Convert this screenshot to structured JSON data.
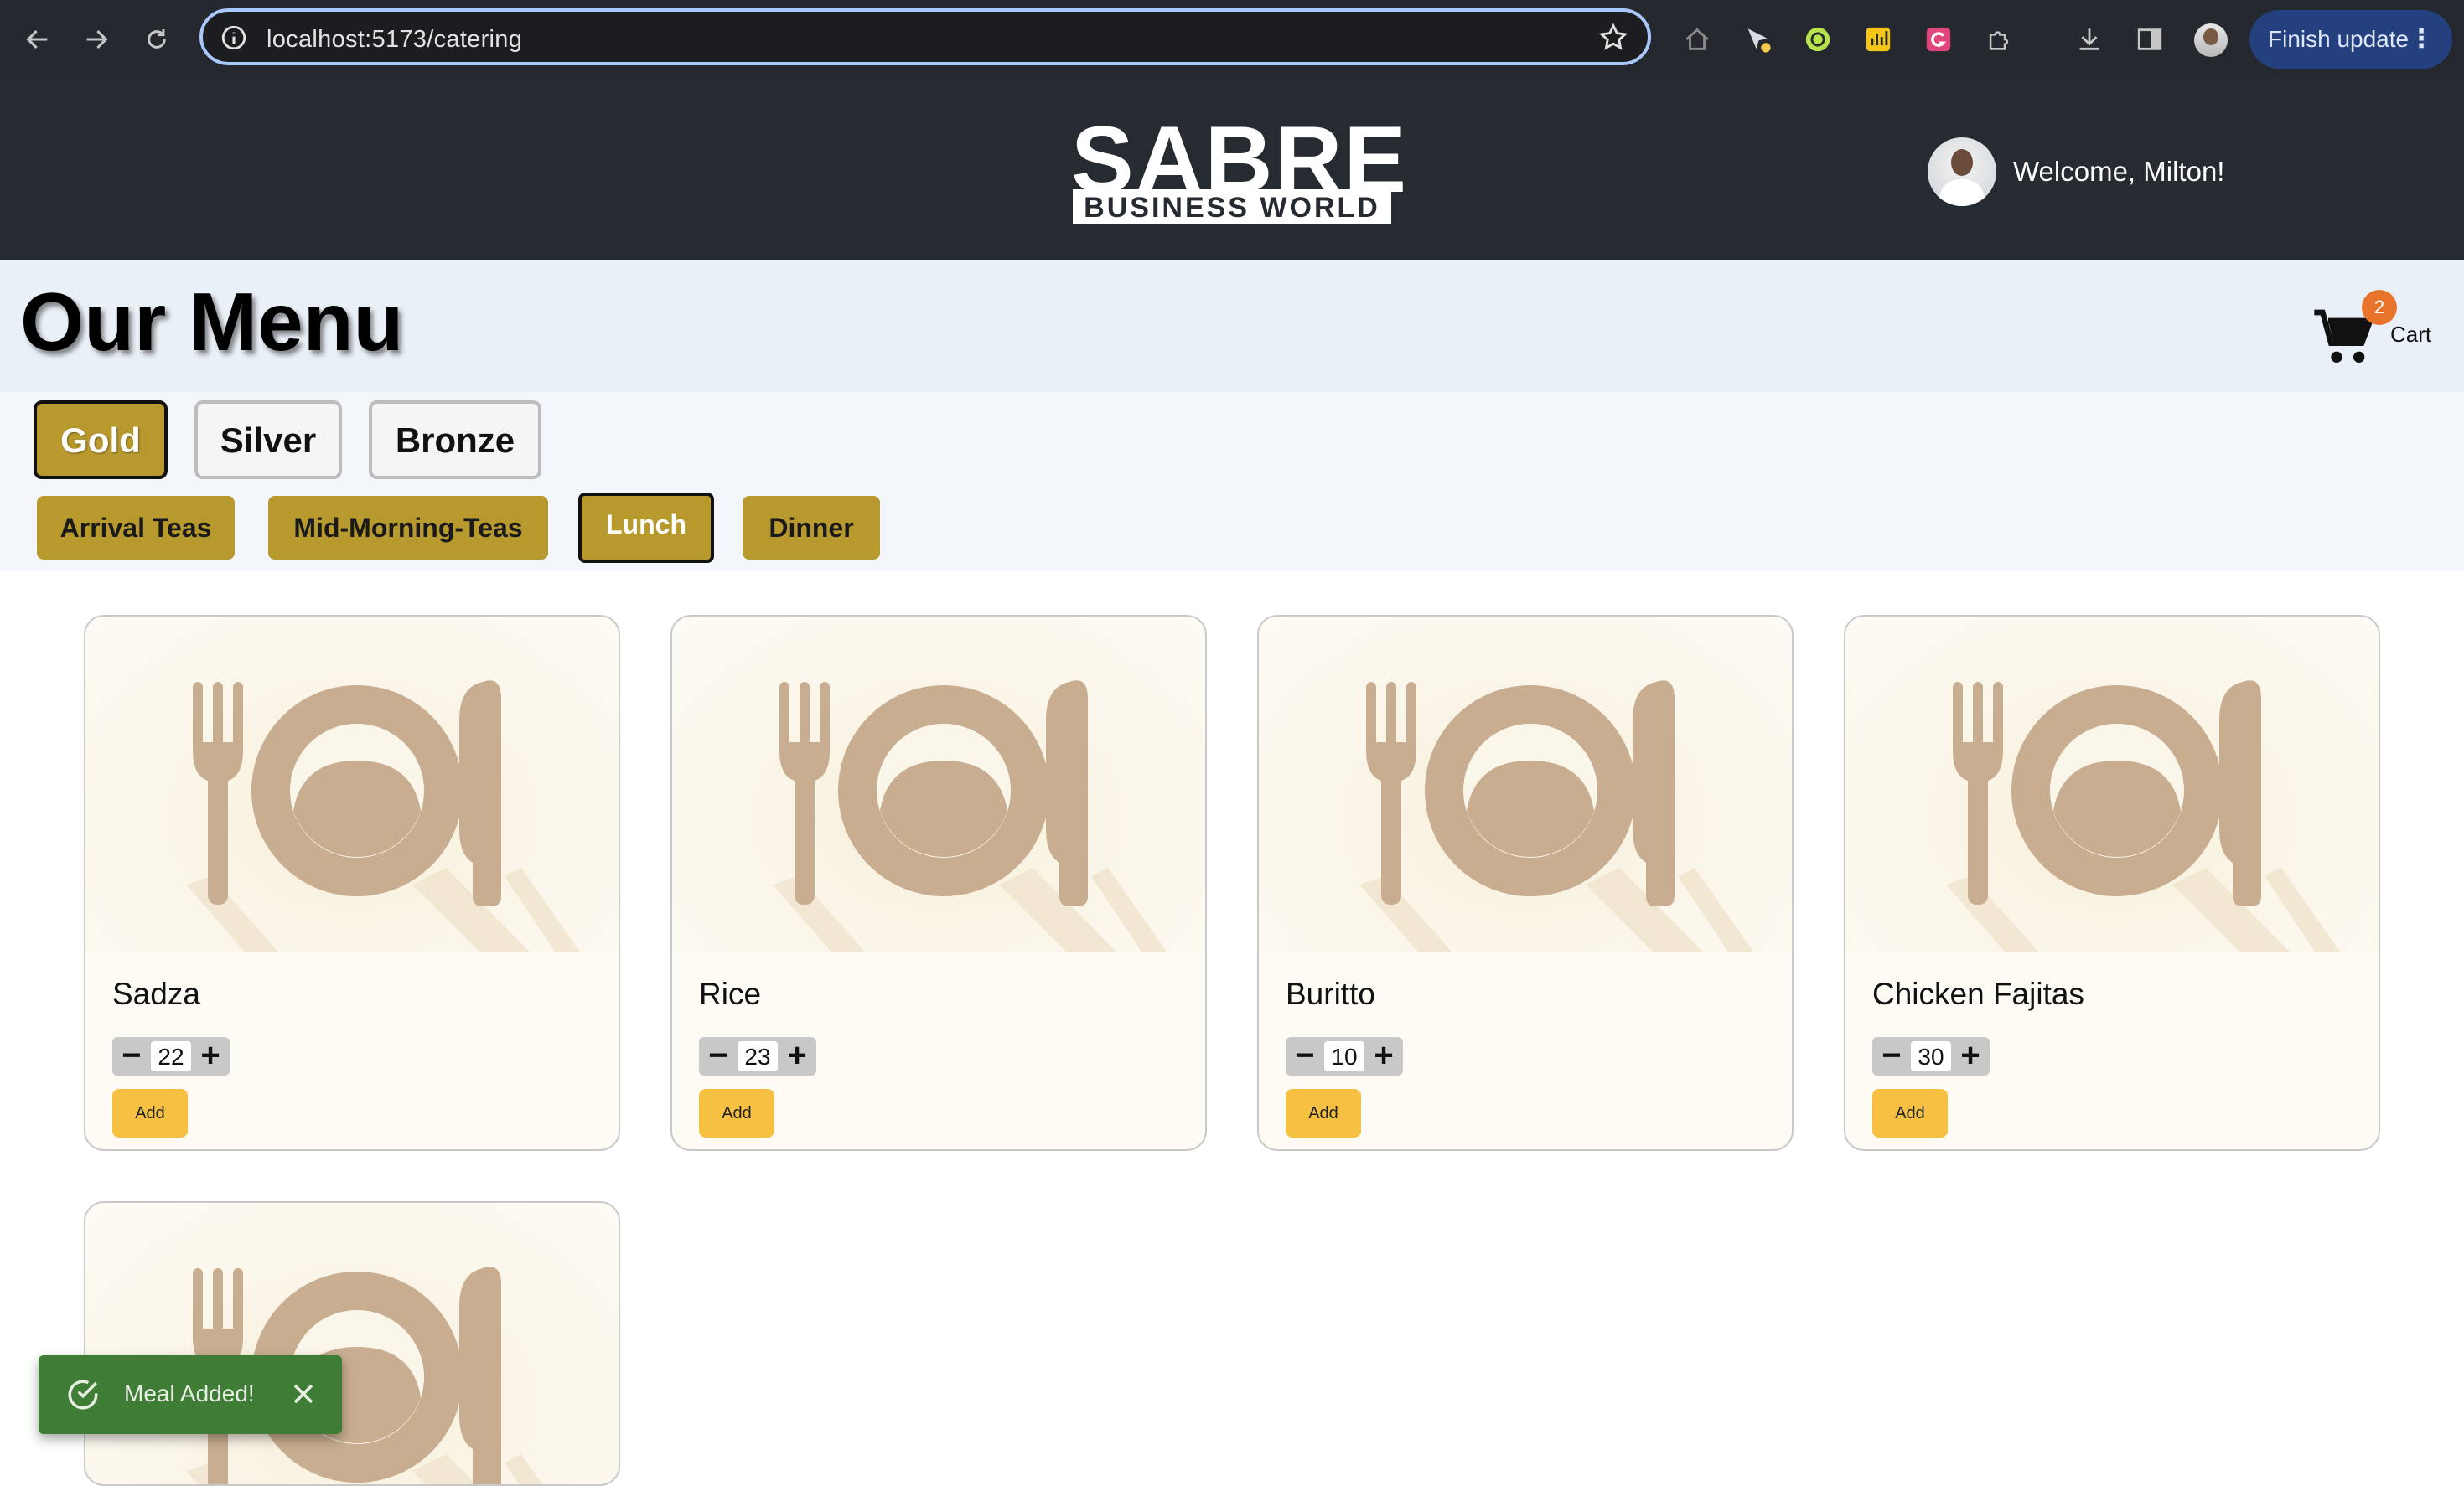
{
  "browser": {
    "url": "localhost:5173/catering",
    "finish_update_label": "Finish update"
  },
  "header": {
    "logo_text": "SABRE",
    "logo_subtext": "BUSINESS WORLD",
    "welcome": "Welcome, Milton!"
  },
  "page": {
    "title": "Our Menu",
    "cart_label": "Cart",
    "cart_count": "2"
  },
  "tiers": [
    {
      "label": "Gold",
      "active": true
    },
    {
      "label": "Silver",
      "active": false
    },
    {
      "label": "Bronze",
      "active": false
    }
  ],
  "meals": [
    {
      "label": "Arrival Teas",
      "active": false
    },
    {
      "label": "Mid-Morning-Teas",
      "active": false
    },
    {
      "label": "Lunch",
      "active": true
    },
    {
      "label": "Dinner",
      "active": false
    }
  ],
  "items": [
    {
      "name": "Sadza",
      "qty": "22",
      "add_label": "Add"
    },
    {
      "name": "Rice",
      "qty": "23",
      "add_label": "Add"
    },
    {
      "name": "Buritto",
      "qty": "10",
      "add_label": "Add"
    },
    {
      "name": "Chicken Fajitas",
      "qty": "30",
      "add_label": "Add"
    }
  ],
  "toast": {
    "message": "Meal Added!"
  },
  "colors": {
    "gold": "#b8992e",
    "add_button": "#f6c042",
    "toast": "#3f7d36",
    "header": "#262a31"
  }
}
